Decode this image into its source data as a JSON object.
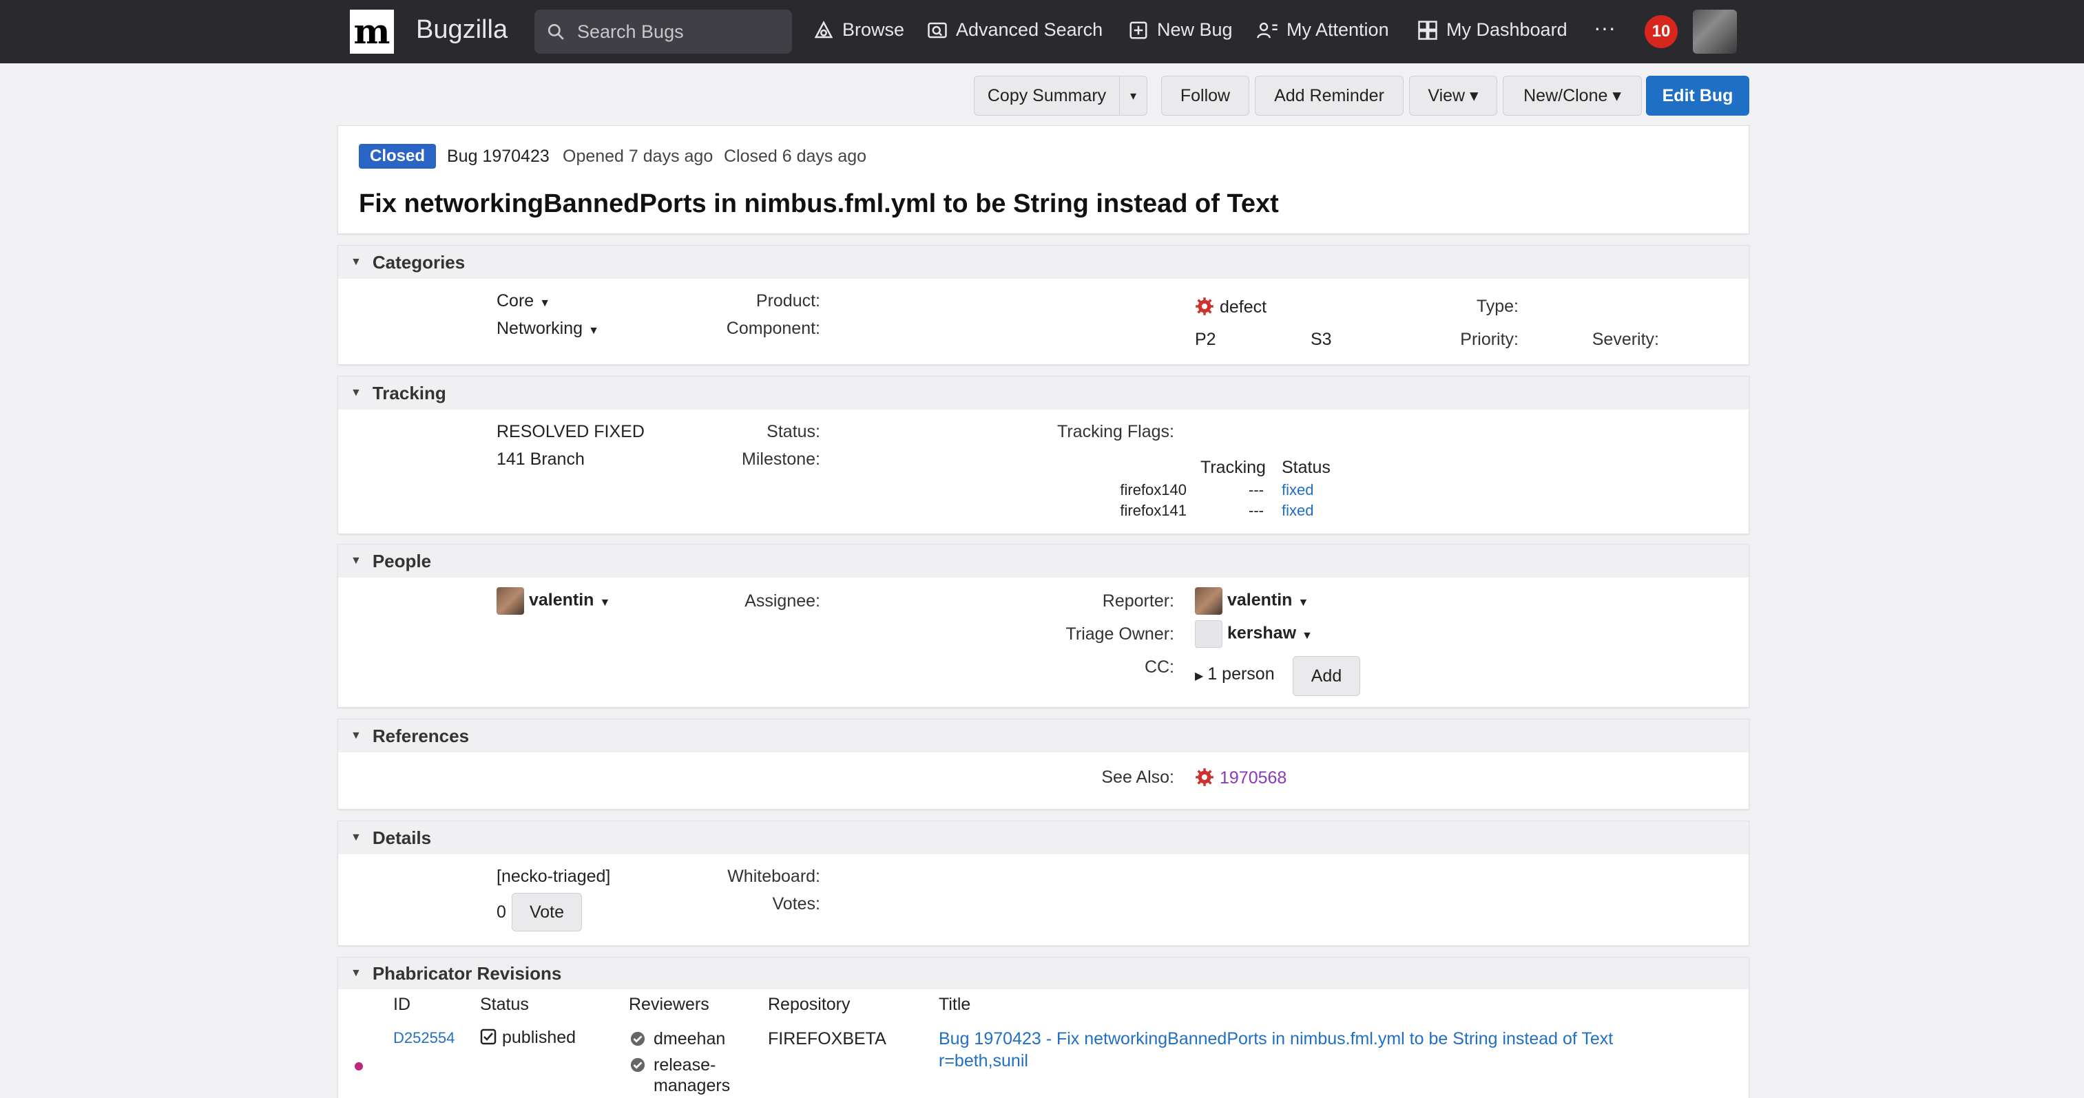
{
  "topbar": {
    "logo_letter": "m",
    "brand": "Bugzilla",
    "search_placeholder": "Search Bugs",
    "nav": [
      "Browse",
      "Advanced Search",
      "New Bug",
      "My Attention",
      "My Dashboard"
    ],
    "more": "···",
    "notification_count": "10"
  },
  "actions": {
    "copy_summary": "Copy Summary",
    "copy_menu_caret": "▾",
    "follow": "Follow",
    "add_reminder": "Add Reminder",
    "view": "View ▾",
    "new_clone": "New/Clone ▾",
    "edit_bug": "Edit Bug"
  },
  "summary": {
    "status_badge": "Closed",
    "bug_id": "Bug 1970423",
    "opened": "Opened 7 days ago",
    "closed": "Closed 6 days ago",
    "title": "Fix networkingBannedPorts in nimbus.fml.yml to be String instead of Text"
  },
  "categories": {
    "heading": "Categories",
    "product_label": "Product:",
    "product": "Core",
    "component_label": "Component:",
    "component": "Networking",
    "type_label": "Type:",
    "type": "defect",
    "priority_label": "Priority:",
    "priority": "P2",
    "severity_label": "Severity:",
    "severity": "S3"
  },
  "tracking": {
    "heading": "Tracking",
    "status_label": "Status:",
    "status": "RESOLVED FIXED",
    "milestone_label": "Milestone:",
    "milestone": "141 Branch",
    "flags_label": "Tracking Flags:",
    "col_tracking": "Tracking",
    "col_status": "Status",
    "rows": [
      {
        "name": "firefox140",
        "tracking": "---",
        "status": "fixed"
      },
      {
        "name": "firefox141",
        "tracking": "---",
        "status": "fixed"
      }
    ]
  },
  "people": {
    "heading": "People",
    "assignee_label": "Assignee:",
    "assignee": "valentin",
    "reporter_label": "Reporter:",
    "reporter": "valentin",
    "triage_label": "Triage Owner:",
    "triage": "kershaw",
    "cc_label": "CC:",
    "cc": "1 person",
    "cc_add": "Add"
  },
  "references": {
    "heading": "References",
    "see_also_label": "See Also:",
    "see_also": "1970568"
  },
  "details": {
    "heading": "Details",
    "whiteboard_label": "Whiteboard:",
    "whiteboard": "[necko-triaged]",
    "votes_label": "Votes:",
    "votes": "0",
    "vote_button": "Vote"
  },
  "phabricator": {
    "heading": "Phabricator Revisions",
    "cols": {
      "id": "ID",
      "status": "Status",
      "reviewers": "Reviewers",
      "repository": "Repository",
      "title": "Title"
    },
    "revision": {
      "id": "D252554",
      "status": "published",
      "reviewers": [
        "dmeehan",
        "release-",
        "managers"
      ],
      "repository": "FIREFOXBETA",
      "title_line1": "Bug 1970423 - Fix networkingBannedPorts in nimbus.fml.yml to be String instead of Text",
      "title_line2": "r=beth,sunil"
    }
  },
  "colors": {
    "primary": "#1f6fc5",
    "badge_red": "#d7261e",
    "defect_red": "#d0312d"
  }
}
